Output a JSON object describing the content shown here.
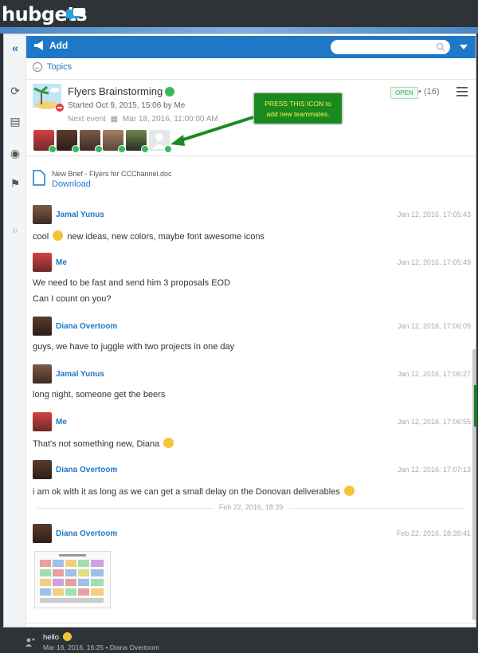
{
  "app": {
    "logo_text": "hubgets"
  },
  "toolbar": {
    "add_label": "Add",
    "search_placeholder": ""
  },
  "nav": {
    "topics_label": "Topics"
  },
  "topic": {
    "title": "Flyers Brainstorming",
    "started": "Started Oct 9, 2015, 15:06 by Me",
    "next_event_label": "Next event",
    "next_event_date": "Mar 18, 2016, 11:00:00 AM",
    "status_badge": "OPEN",
    "comment_count": "(16)"
  },
  "callout": {
    "text_line1": "PRESS THIS ICON to",
    "text_line2": "add new teammates."
  },
  "attachment": {
    "file_name": "New Brief - Flyers for CCChannel.doc",
    "download_label": "Download"
  },
  "messages": [
    {
      "author": "Jamal Yunus",
      "time": "Jan 12, 2016, 17:05:43",
      "lines": [
        "cool",
        "new ideas, new colors, maybe font awesome icons"
      ]
    },
    {
      "author": "Me",
      "time": "Jan 12, 2016, 17:05:49",
      "lines": [
        "We need to be fast and send him 3 proposals EOD",
        "Can I count on you?"
      ]
    },
    {
      "author": "Diana Overtoom",
      "time": "Jan 12, 2016, 17:06:09",
      "lines": [
        "guys, we have to juggle with two projects in one day"
      ]
    },
    {
      "author": "Jamal Yunus",
      "time": "Jan 12, 2016, 17:06:27",
      "lines": [
        "long night, someone get the beers"
      ]
    },
    {
      "author": "Me",
      "time": "Jan 12, 2016, 17:06:55",
      "lines": [
        "That's not something new, Diana"
      ]
    },
    {
      "author": "Diana Overtoom",
      "time": "Jan 12, 2016, 17:07:13",
      "lines": [
        "i am ok with it as long as we can get a small delay on the Donovan deliverables"
      ]
    },
    {
      "author": "Diana Overtoom",
      "time": "Feb 22, 2016, 18:39:41",
      "lines": []
    }
  ],
  "date_separator": "Feb 22, 2016, 18:39",
  "notification": {
    "text": "hello",
    "meta": "Mar 16, 2016, 16:25 • Diana Overtoom"
  },
  "colors": {
    "accent": "#1f77c8",
    "callout_bg": "#1a8a1e",
    "callout_text": "#ffee55",
    "online": "#3cb85c"
  }
}
